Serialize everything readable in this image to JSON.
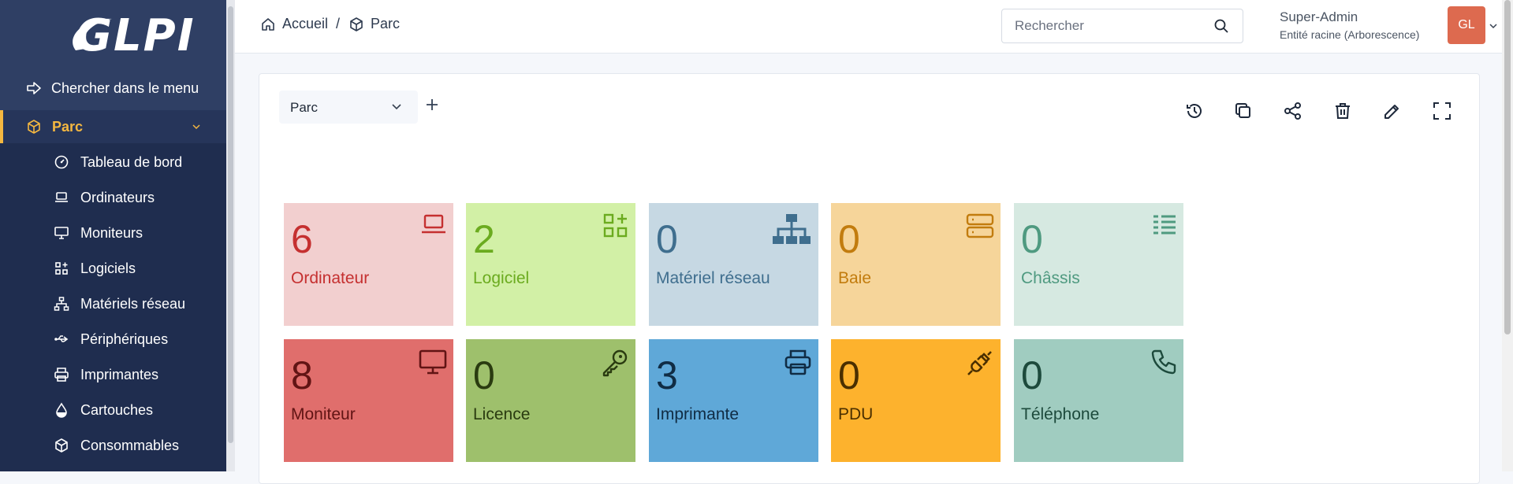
{
  "app": {
    "logo_text": "GLPI"
  },
  "sidebar": {
    "search_label": "Chercher dans le menu",
    "active_section": "Parc",
    "items": [
      {
        "label": "Tableau de bord",
        "icon": "gauge-icon"
      },
      {
        "label": "Ordinateurs",
        "icon": "laptop-icon"
      },
      {
        "label": "Moniteurs",
        "icon": "monitor-icon"
      },
      {
        "label": "Logiciels",
        "icon": "apps-icon"
      },
      {
        "label": "Matériels réseau",
        "icon": "network-icon"
      },
      {
        "label": "Périphériques",
        "icon": "usb-icon"
      },
      {
        "label": "Imprimantes",
        "icon": "printer-icon"
      },
      {
        "label": "Cartouches",
        "icon": "droplet-icon"
      },
      {
        "label": "Consommables",
        "icon": "box-icon"
      }
    ]
  },
  "header": {
    "breadcrumb": [
      {
        "label": "Accueil",
        "icon": "home-icon"
      },
      {
        "label": "Parc",
        "icon": "box-icon"
      }
    ],
    "breadcrumb_separator": "/",
    "search_placeholder": "Rechercher",
    "user_name": "Super-Admin",
    "user_entity": "Entité racine (Arborescence)",
    "avatar_initials": "GL"
  },
  "dashboard": {
    "selected": "Parc",
    "toolbar": [
      "history-icon",
      "copy-icon",
      "share-icon",
      "trash-icon",
      "edit-icon",
      "fullscreen-icon"
    ],
    "tiles": [
      {
        "value": "6",
        "label": "Ordinateur",
        "icon": "laptop-icon",
        "bg": "#f2cfcf",
        "fg": "#c53030"
      },
      {
        "value": "2",
        "label": "Logiciel",
        "icon": "apps-icon",
        "bg": "#d2f0a6",
        "fg": "#6bab1f"
      },
      {
        "value": "0",
        "label": "Matériel réseau",
        "icon": "network-icon",
        "bg": "#c6d8e3",
        "fg": "#3f6e8e"
      },
      {
        "value": "0",
        "label": "Baie",
        "icon": "server-icon",
        "bg": "#f6d59a",
        "fg": "#c27c0e"
      },
      {
        "value": "0",
        "label": "Châssis",
        "icon": "list-icon",
        "bg": "#d6e9e1",
        "fg": "#4f9a80"
      },
      {
        "value": "8",
        "label": "Moniteur",
        "icon": "monitor-icon",
        "bg": "#e06e6c",
        "fg": "#611414"
      },
      {
        "value": "0",
        "label": "Licence",
        "icon": "key-icon",
        "bg": "#9ec06c",
        "fg": "#2a3b10"
      },
      {
        "value": "3",
        "label": "Imprimante",
        "icon": "printer-icon",
        "bg": "#5fa8d8",
        "fg": "#102c44"
      },
      {
        "value": "0",
        "label": "PDU",
        "icon": "plug-icon",
        "bg": "#fdb22d",
        "fg": "#4a2f00"
      },
      {
        "value": "0",
        "label": "Téléphone",
        "icon": "phone-icon",
        "bg": "#a0ccc0",
        "fg": "#1d4a3c"
      }
    ]
  }
}
